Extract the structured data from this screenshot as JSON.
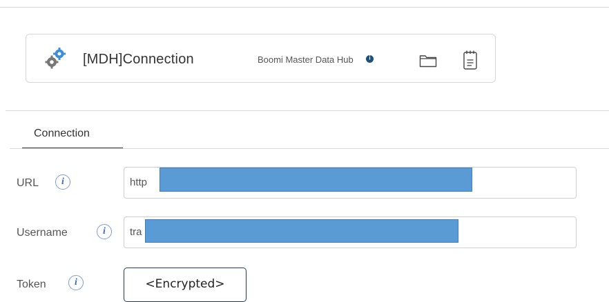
{
  "header": {
    "title": "[MDH]Connection",
    "connector_type": "Boomi Master Data Hub"
  },
  "tabs": [
    {
      "label": "Connection"
    }
  ],
  "form": {
    "url": {
      "label": "URL",
      "value": "http"
    },
    "username": {
      "label": "Username",
      "value": "tra"
    },
    "token": {
      "label": "Token",
      "button_label": "<Encrypted>"
    }
  },
  "icons": {
    "component": "gears-icon",
    "info": "info-icon",
    "folder": "folder-icon",
    "notes": "notes-icon"
  },
  "colors": {
    "accent": "#5b9bd5",
    "info_dot": "#1f4e79",
    "tab_underline": "#333333"
  }
}
